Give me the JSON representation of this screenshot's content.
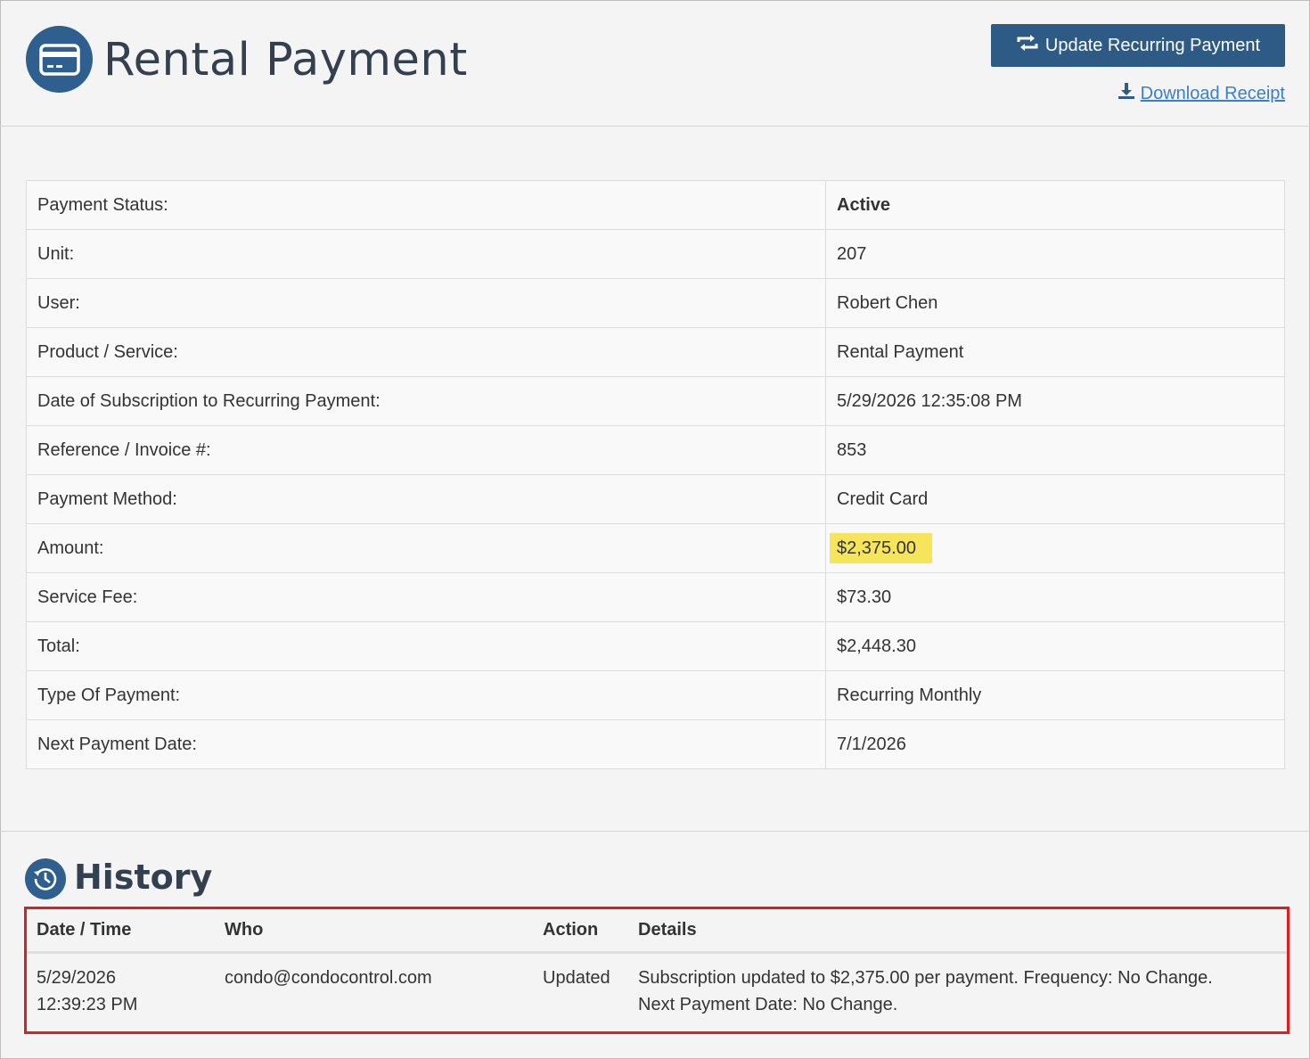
{
  "header": {
    "title": "Rental Payment",
    "title_icon": "credit-card-icon",
    "update_button_label": "Update Recurring Payment",
    "update_button_icon": "recurring-arrows-icon",
    "download_link_label": "Download Receipt",
    "download_link_icon": "download-icon"
  },
  "details": [
    {
      "label": "Payment Status:",
      "value": "Active"
    },
    {
      "label": "Unit:",
      "value": "207"
    },
    {
      "label": "User:",
      "value": "Robert Chen"
    },
    {
      "label": "Product / Service:",
      "value": "Rental Payment"
    },
    {
      "label": "Date of Subscription to Recurring Payment:",
      "value": "5/29/2026 12:35:08 PM"
    },
    {
      "label": "Reference / Invoice #:",
      "value": "853"
    },
    {
      "label": "Payment Method:",
      "value": "Credit Card"
    },
    {
      "label": "Amount:",
      "value": "$2,375.00"
    },
    {
      "label": "Service Fee:",
      "value": "$73.30"
    },
    {
      "label": "Total:",
      "value": "$2,448.30"
    },
    {
      "label": "Type Of Payment:",
      "value": "Recurring Monthly"
    },
    {
      "label": "Next Payment Date:",
      "value": "7/1/2026"
    }
  ],
  "history": {
    "title": "History",
    "icon": "history-clock-icon",
    "columns": [
      "Date / Time",
      "Who",
      "Action",
      "Details"
    ],
    "rows": [
      {
        "date": "5/29/2026",
        "time": "12:39:23 PM",
        "who": "condo@condocontrol.com",
        "action": "Updated",
        "details_line1": "Subscription updated to $2,375.00 per payment. Frequency: No Change.",
        "details_line2": "Next Payment Date: No Change."
      }
    ]
  },
  "colors": {
    "accent": "#2e5a86",
    "link": "#3a80c9",
    "highlight": "#f6e45a",
    "callout_border": "#e01e1e"
  }
}
